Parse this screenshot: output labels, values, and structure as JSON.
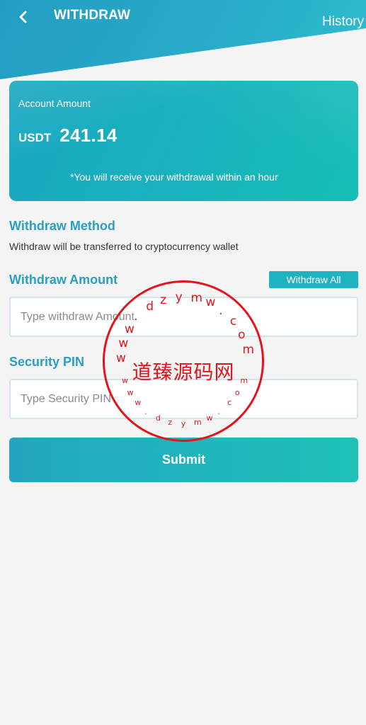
{
  "header": {
    "title": "WITHDRAW",
    "history_label": "History",
    "back_icon": "chevron-left-icon"
  },
  "account": {
    "label": "Account Amount",
    "currency": "USDT",
    "amount": "241.14",
    "note": "*You will receive your withdrawal within an hour"
  },
  "method": {
    "title": "Withdraw Method",
    "description": "Withdraw will be transferred to cryptocurrency wallet"
  },
  "amount_section": {
    "title": "Withdraw Amount",
    "withdraw_all_label": "Withdraw All",
    "placeholder": "Type withdraw Amount",
    "value": ""
  },
  "pin_section": {
    "title": "Security PIN",
    "placeholder": "Type Security PIN",
    "value": ""
  },
  "submit_label": "Submit",
  "watermark": {
    "center_text": "道臻源码网",
    "outer_ring_text": "www.dzymw.com",
    "inner_ring_text": "www.dzymw.com"
  },
  "colors": {
    "brand_teal": "#2a9fc2",
    "accent": "#1fc1b8",
    "stamp_red": "#e4141b",
    "background": "#f4f4f4"
  }
}
